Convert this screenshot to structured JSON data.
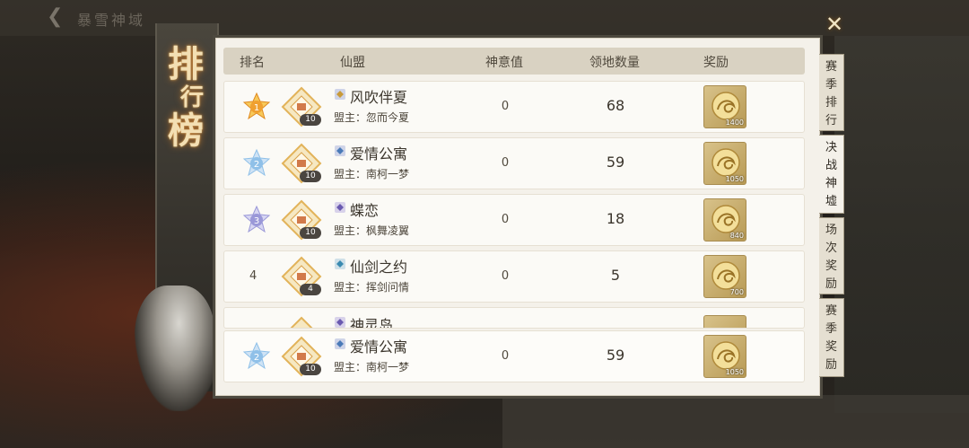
{
  "background": {
    "title": "暴雪神域"
  },
  "banner": {
    "title": [
      "排",
      "行",
      "榜"
    ]
  },
  "header": {
    "rank": "排名",
    "guild": "仙盟",
    "divine_value": "神意值",
    "territory": "领地数量",
    "reward": "奖励"
  },
  "rows": [
    {
      "rank": "1",
      "rank_color": "#f0a030",
      "emblem_level": "10",
      "guild_name": "风吹伴夏",
      "leader": "盟主：忽而今夏",
      "divine_value": "0",
      "territory": "68",
      "reward_count": "1400"
    },
    {
      "rank": "2",
      "rank_color": "#8fc0e8",
      "emblem_level": "10",
      "guild_name": "爱情公寓",
      "leader": "盟主：南柯一梦",
      "divine_value": "0",
      "territory": "59",
      "reward_count": "1050"
    },
    {
      "rank": "3",
      "rank_color": "#9a98d8",
      "emblem_level": "10",
      "guild_name": "蝶恋",
      "leader": "盟主：枫舞凌翼",
      "divine_value": "0",
      "territory": "18",
      "reward_count": "840"
    },
    {
      "rank": "4",
      "emblem_level": "4",
      "guild_name": "仙剑之约",
      "leader": "盟主：挥剑问情",
      "divine_value": "0",
      "territory": "5",
      "reward_count": "700"
    },
    {
      "guild_name": "神灵岛"
    }
  ],
  "own_row": {
    "rank": "2",
    "rank_color": "#8fc0e8",
    "emblem_level": "10",
    "guild_name": "爱情公寓",
    "leader": "盟主：南柯一梦",
    "divine_value": "0",
    "territory": "59",
    "reward_count": "1050"
  },
  "tabs": [
    {
      "label": [
        "赛",
        "季",
        "排",
        "行"
      ],
      "active": false
    },
    {
      "label": [
        "决",
        "战",
        "神",
        "墟"
      ],
      "active": true
    },
    {
      "label": [
        "场",
        "次",
        "奖",
        "励"
      ],
      "active": false
    },
    {
      "label": [
        "赛",
        "季",
        "奖",
        "励"
      ],
      "active": false
    }
  ],
  "close_label": "✕",
  "back_label": "❮"
}
